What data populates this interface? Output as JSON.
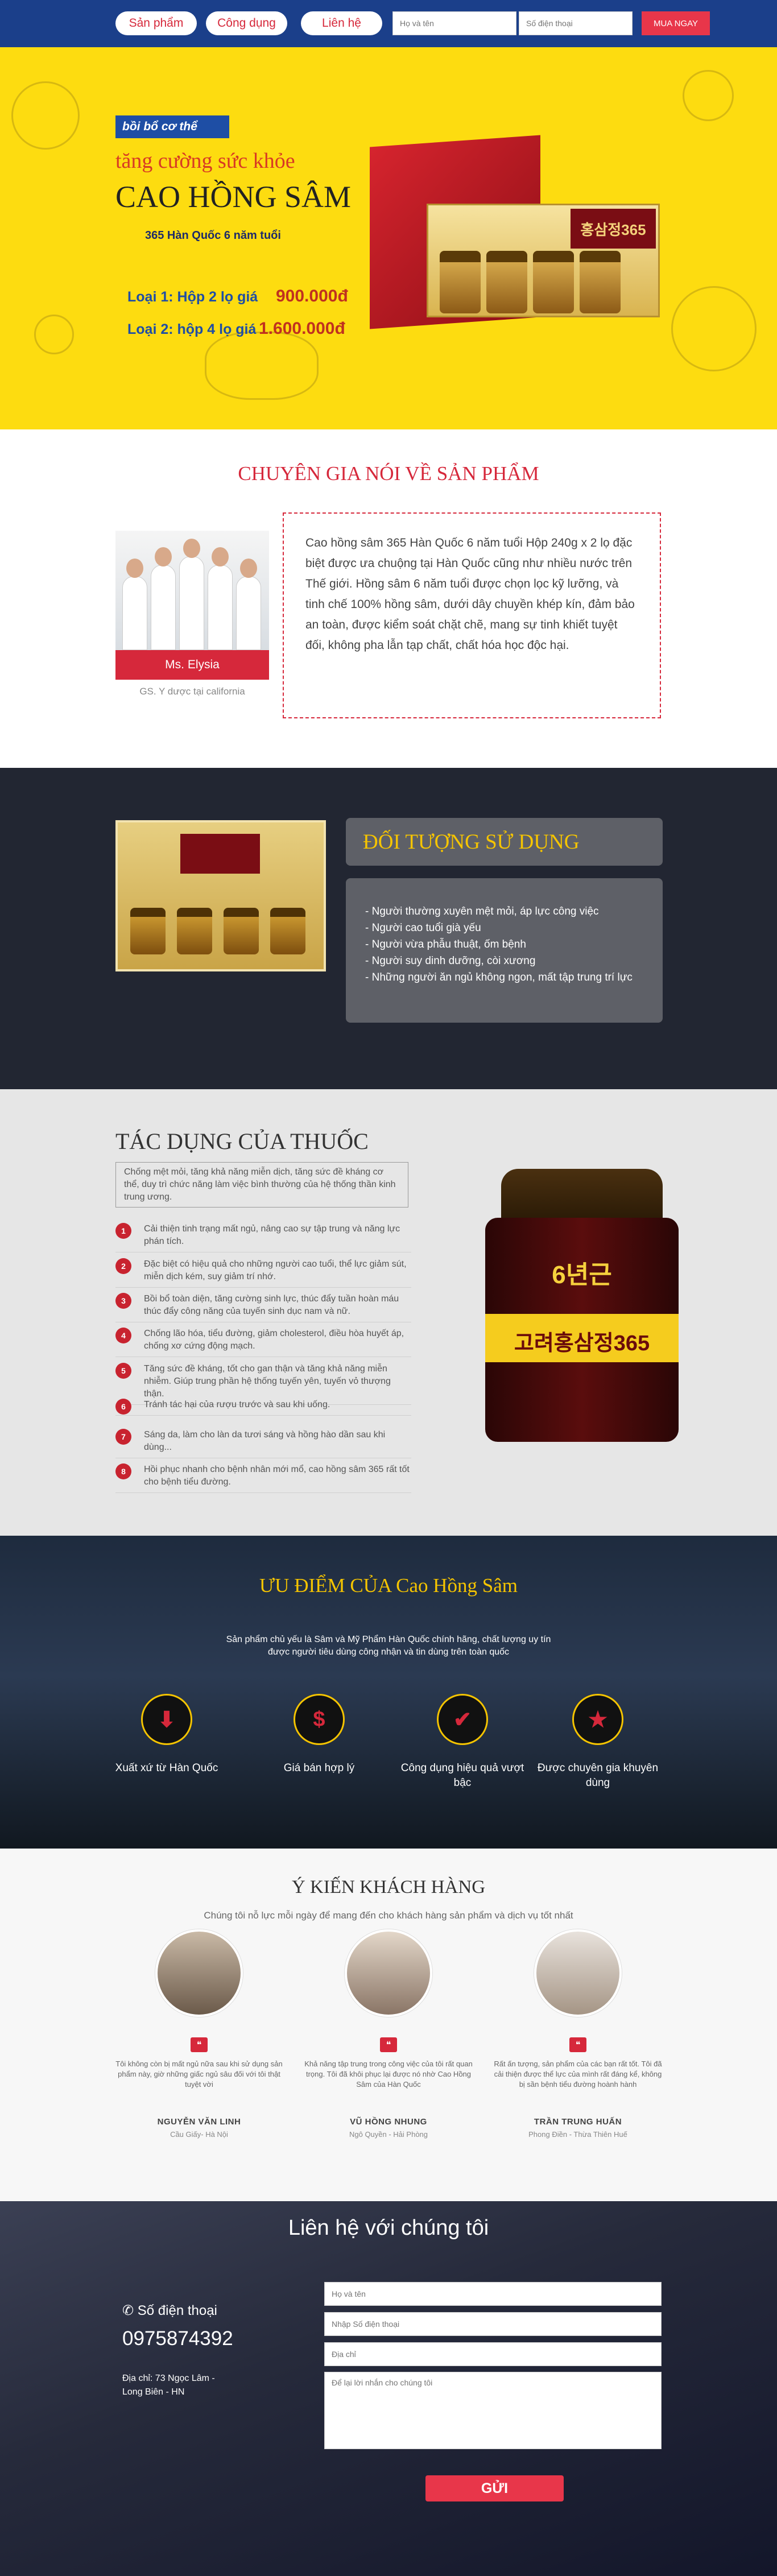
{
  "nav": {
    "product_label": "Sản phẩm",
    "usage_label": "Công dụng",
    "contact_label": "Liên hệ",
    "name_placeholder": "Họ và tên",
    "phone_placeholder": "Số điện thoại",
    "submit_label": "MUA NGAY"
  },
  "hero": {
    "badge": "bồi bổ cơ thể",
    "subtitle": "tăng cường sức khỏe",
    "title": "CAO HỒNG SÂM",
    "origin": "365 Hàn Quốc 6 năm tuổi",
    "offers": [
      {
        "label": "Loại 1: Hộp 2 lọ giá",
        "price": "900.000đ"
      },
      {
        "label": "Loại 2: hộp 4 lọ giá",
        "price": "1.600.000đ"
      }
    ],
    "box_label": "홍삼정365"
  },
  "expert": {
    "title": "CHUYÊN GIA NÓI VỀ SẢN PHẨM",
    "name": "Ms. Elysia",
    "role": "GS. Y dược tại california",
    "quote": "Cao hồng sâm 365 Hàn Quốc 6 năm tuổi Hộp 240g x 2 lọ đặc biệt được ưa chuộng tại Hàn Quốc cũng như nhiều nước trên Thế giới. Hồng sâm 6 năm tuổi được chọn lọc kỹ lưỡng, và tinh chế 100% hồng sâm, dưới dây chuyền khép kín, đảm bảo an toàn, được kiểm soát chặt chẽ, mang sự tinh khiết tuyệt đối, không pha lẫn tạp chất, chất hóa học độc hại."
  },
  "audience": {
    "title": "ĐỐI TƯỢNG SỬ DỤNG",
    "items": [
      "- Người thường xuyên mệt mỏi, áp lực công việc",
      "- Người cao tuổi già yếu",
      "- Người vừa phẫu thuật, ốm bệnh",
      "- Người suy dinh dưỡng, còi xương",
      "- Những người ăn ngủ không ngon, mất tập trung trí lực"
    ]
  },
  "effects": {
    "title": "TÁC DỤNG CỦA THUỐC",
    "intro": "Chống mệt mỏi, tăng khả năng miễn dịch, tăng sức đề kháng cơ thể, duy trì chức năng làm việc bình thường của hệ thống thần kinh trung ương.",
    "items": [
      {
        "num": "1",
        "text": "Cải thiện tinh trạng mất ngủ, nâng cao sự tập trung và năng lực phán tích."
      },
      {
        "num": "2",
        "text": "Đặc biệt có hiệu quả cho những người cao tuổi, thể lực giảm sút, miễn dịch kém, suy giảm trí nhớ."
      },
      {
        "num": "3",
        "text": "Bồi bổ toàn diện, tăng cường sinh lực, thúc đẩy tuần hoàn máu thúc đẩy công năng của tuyến sinh dục nam và nữ."
      },
      {
        "num": "4",
        "text": "Chống lão hóa, tiểu đường, giảm cholesterol, điều hòa huyết áp, chống xơ cứng động mạch."
      },
      {
        "num": "5",
        "text": "Tăng sức đề kháng, tốt cho gan thận và tăng khả năng miễn nhiễm. Giúp trung phần hệ thống tuyến yên, tuyến vỏ thượng thận."
      },
      {
        "num": "6",
        "text": "Tránh tác hại của rượu trước và sau khi uống."
      },
      {
        "num": "7",
        "text": "Sáng da, làm cho làn da tươi sáng và hồng hào dần sau khi dùng..."
      },
      {
        "num": "8",
        "text": "Hồi phục nhanh cho bệnh nhân mới mổ, cao hồng sâm 365 rất tốt cho bệnh tiểu đường."
      }
    ],
    "jar_label_top": "6년근",
    "jar_label_main": "고려홍삼정365"
  },
  "advantages": {
    "title": "ƯU ĐIỂM CỦA Cao Hồng Sâm",
    "subtitle": "Sản phẩm chủ yếu là Sâm và Mỹ Phẩm Hàn Quốc chính hãng, chất lượng uy tín được người tiêu dùng công nhận và tin dùng trên toàn quốc",
    "items": [
      {
        "icon": "download-icon",
        "label": "Xuất xứ từ Hàn Quốc"
      },
      {
        "icon": "dollar-icon",
        "label": "Giá bán hợp lý"
      },
      {
        "icon": "check-icon",
        "label": "Công dụng hiệu quả vượt bậc"
      },
      {
        "icon": "star-icon",
        "label": "Được chuyên gia khuyên dùng"
      }
    ]
  },
  "testimonials": {
    "title": "Ý KIẾN KHÁCH HÀNG",
    "subtitle": "Chúng tôi nỗ lực mỗi ngày để mang đến cho khách hàng sản phẩm và dịch vụ tốt nhất",
    "items": [
      {
        "text": "Tôi không còn bị mất ngủ nữa sau khi sử dụng sản phẩm này, giờ những giấc ngủ sâu đối với tôi thật tuyệt vời",
        "name": "NGUYỄN VĂN LINH",
        "location": "Cầu Giấy- Hà Nội"
      },
      {
        "text": "Khả năng tập trung trong công việc của tôi rất quan trọng. Tôi đã khôi phục lại được nó nhờ Cao Hồng Sâm của Hàn Quốc",
        "name": "VŨ HỒNG NHUNG",
        "location": "Ngô Quyền - Hải Phòng"
      },
      {
        "text": "Rất ấn tượng, sản phẩm của các bạn rất tốt. Tôi đã cải thiện được thể lực của mình rất đáng kể, không bị sần bệnh tiểu đường hoành hành",
        "name": "TRẦN TRUNG HUẤN",
        "location": "Phong Điền - Thừa Thiên Huế"
      }
    ]
  },
  "contact": {
    "title": "Liên hệ với chúng tôi",
    "phone_label": "Số điện thoại",
    "phone": "0975874392",
    "address": "Địa chỉ: 73 Ngọc Lâm - Long Biên - HN",
    "name_placeholder": "Họ và tên",
    "phone_placeholder": "Nhập Số điện thoại",
    "address_placeholder": "Địa chỉ",
    "message_placeholder": "Để lại lời nhắn cho chúng tôi",
    "send_label": "GỬI"
  },
  "colors": {
    "nav_bg": "#1b3f8a",
    "hero_bg": "#fddc10",
    "accent_red": "#d6283b",
    "accent_yellow": "#f5c400"
  }
}
